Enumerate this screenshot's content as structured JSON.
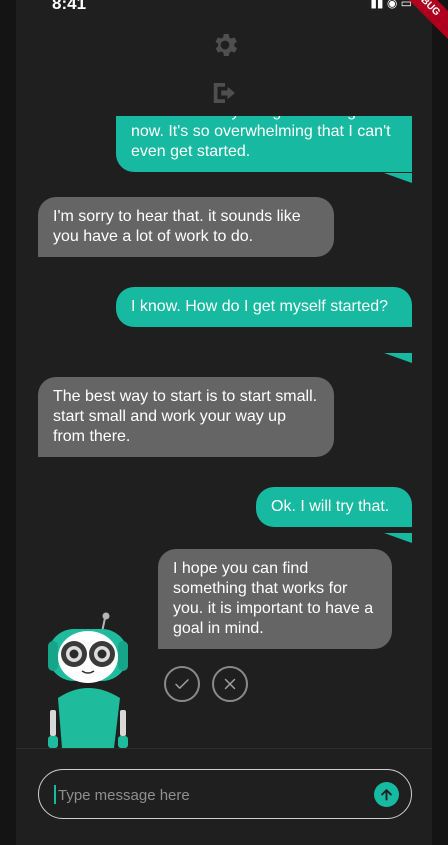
{
  "status_bar": {
    "time": "8:41",
    "icons": "▮▮ ◉ ▭"
  },
  "debug_banner": "DEBUG",
  "header": {
    "settings_icon": "gear-icon",
    "logout_icon": "logout-icon"
  },
  "messages": [
    {
      "sender": "user",
      "text": "I have so many assignments right now. It's so overwhelming that I can't even get started."
    },
    {
      "sender": "bot",
      "text": "I'm sorry to hear that. it sounds like you have a lot of work to do."
    },
    {
      "sender": "user",
      "text": "I know. How do I get myself started?"
    },
    {
      "sender": "bot",
      "text": "The best way to start is to start small. start small and work your way up from there."
    },
    {
      "sender": "user",
      "text": "Ok. I will try that."
    },
    {
      "sender": "bot",
      "text": "I hope you can find something that works for you. it is important to have a goal in mind."
    }
  ],
  "feedback": {
    "accept_icon": "check-icon",
    "reject_icon": "x-icon"
  },
  "composer": {
    "placeholder": "Type message here",
    "value": "",
    "send_icon": "arrow-up-icon"
  },
  "colors": {
    "accent": "#17b9a0",
    "bot_bubble": "#656565",
    "background": "#1f1f1f"
  }
}
